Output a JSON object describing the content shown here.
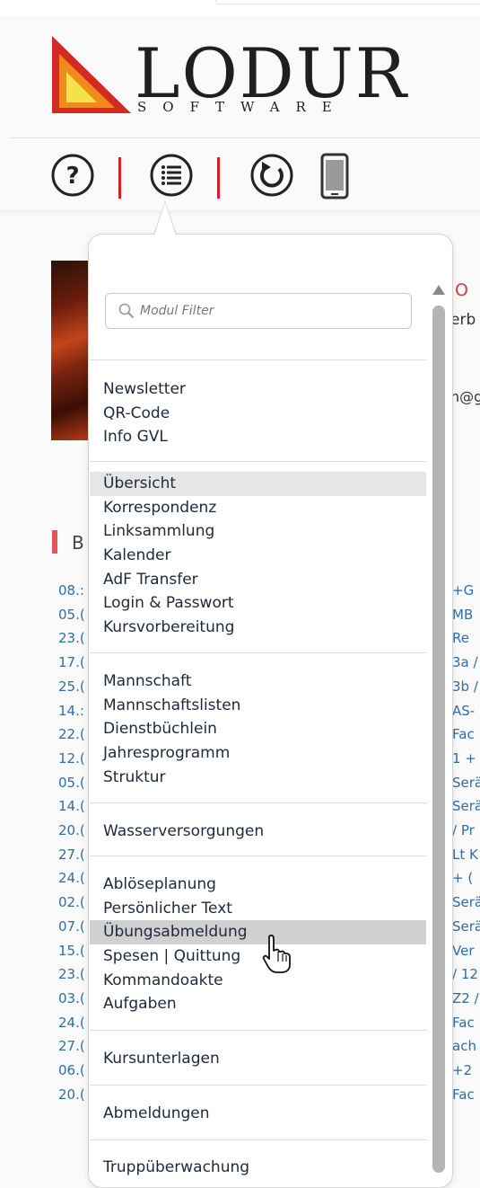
{
  "logo": {
    "word": "LODUR",
    "sub": "SOFTWARE"
  },
  "toolbar": {
    "help_icon": "help-icon",
    "menu_icon": "list-menu-icon",
    "refresh_icon": "refresh-icon",
    "mobile_icon": "mobile-phone-icon",
    "separator_color": "#d32027"
  },
  "filter": {
    "placeholder": "Modul Filter"
  },
  "menu": {
    "groups": [
      {
        "items": [
          "Newsletter",
          "QR-Code",
          "Info GVL"
        ]
      },
      {
        "items": [
          "Übersicht",
          "Korrespondenz",
          "Linksammlung",
          "Kalender",
          "AdF Transfer",
          "Login & Passwort",
          "Kursvorbereitung"
        ]
      },
      {
        "items": [
          "Mannschaft",
          "Mannschaftslisten",
          "Dienstbüchlein",
          "Jahresprogramm",
          "Struktur"
        ]
      },
      {
        "items": [
          "Wasserversorgungen"
        ]
      },
      {
        "items": [
          "Ablöseplanung",
          "Persönlicher Text",
          "Übungsabmeldung",
          "Spesen | Quittung",
          "Kommandoakte",
          "Aufgaben"
        ]
      },
      {
        "items": [
          "Kursunterlagen"
        ]
      },
      {
        "items": [
          "Abmeldungen"
        ]
      },
      {
        "items": [
          "Truppüberwachung"
        ]
      }
    ],
    "highlighted": "Übersicht",
    "hovered": "Übungsabmeldung"
  },
  "background": {
    "section_letter": "B",
    "right_top": "O",
    "right_a": "erb",
    "right_b": "n@g",
    "date_fragments": [
      "08.:",
      "05.(",
      "23.(",
      "17.(",
      "25.(",
      "14.:",
      "22.(",
      "12.(",
      "05.(",
      "14.(",
      "20.(",
      "27.(",
      "24.(",
      "02.(",
      "07.(",
      "15.(",
      "23.(",
      "03.(",
      "24.(",
      "27.(",
      "06.(",
      "20.("
    ],
    "right_fragments": [
      "+G",
      "MB",
      "Re",
      "3a /",
      "3b /",
      "AS-",
      "Fac",
      "1 +",
      "Serä",
      "Serä",
      "/ Pr",
      "Lt K",
      "+ (",
      "Serä",
      "Serä",
      "Ver",
      "/ 12",
      "Z2 /",
      "Fac",
      "ach",
      "+2",
      "Fac"
    ]
  }
}
